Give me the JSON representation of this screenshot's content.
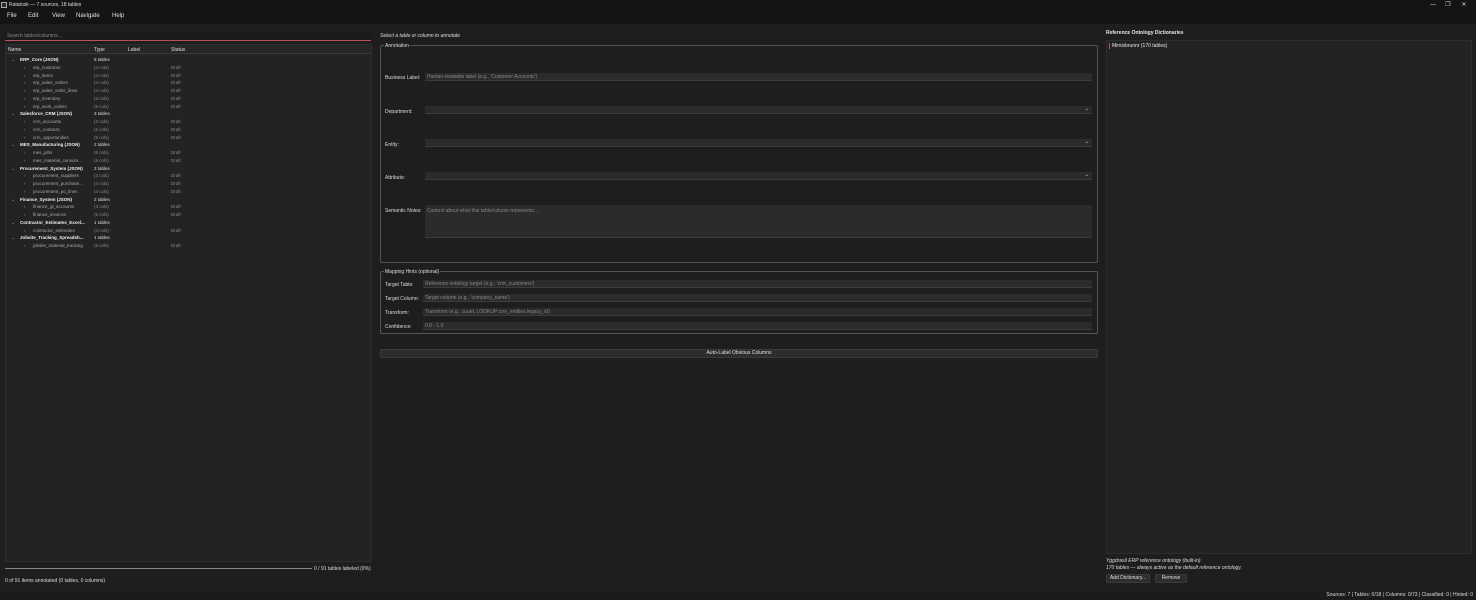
{
  "window": {
    "title": "Ratatosk — 7 sources, 18 tables",
    "icon": "app-icon",
    "controls": [
      "—",
      "❐",
      "✕"
    ]
  },
  "menu": [
    "File",
    "Edit",
    "View",
    "Navigate",
    "Help"
  ],
  "left": {
    "search_placeholder": "Search tables/columns...",
    "columns": [
      "Name",
      "Type",
      "Label",
      "Status"
    ],
    "rows": [
      {
        "kind": "source",
        "name": "ERP_Core (JSON)",
        "type": "6 tables",
        "status": ""
      },
      {
        "kind": "table",
        "name": "erp_customer",
        "type": "(4 cols)",
        "status": "Draft"
      },
      {
        "kind": "table",
        "name": "erp_items",
        "type": "(4 cols)",
        "status": "Draft"
      },
      {
        "kind": "table",
        "name": "erp_sales_orders",
        "type": "(4 cols)",
        "status": "Draft"
      },
      {
        "kind": "table",
        "name": "erp_sales_order_lines",
        "type": "(4 cols)",
        "status": "Draft"
      },
      {
        "kind": "table",
        "name": "erp_inventory",
        "type": "(3 cols)",
        "status": "Draft"
      },
      {
        "kind": "table",
        "name": "erp_work_orders",
        "type": "(5 cols)",
        "status": "Draft"
      },
      {
        "kind": "source",
        "name": "Salesforce_CRM (JSON)",
        "type": "3 tables",
        "status": ""
      },
      {
        "kind": "table",
        "name": "crm_accounts",
        "type": "(3 cols)",
        "status": "Draft"
      },
      {
        "kind": "table",
        "name": "crm_contacts",
        "type": "(5 cols)",
        "status": "Draft"
      },
      {
        "kind": "table",
        "name": "crm_opportunities",
        "type": "(5 cols)",
        "status": "Draft"
      },
      {
        "kind": "source",
        "name": "MES_Manufacturing (JSON)",
        "type": "2 tables",
        "status": ""
      },
      {
        "kind": "table",
        "name": "mes_jobs",
        "type": "(6 cols)",
        "status": "Draft"
      },
      {
        "kind": "table",
        "name": "mes_material_consum...",
        "type": "(5 cols)",
        "status": "Draft"
      },
      {
        "kind": "source",
        "name": "Procurement_System (JSON)",
        "type": "3 tables",
        "status": ""
      },
      {
        "kind": "table",
        "name": "procurement_suppliers",
        "type": "(3 cols)",
        "status": "Draft"
      },
      {
        "kind": "table",
        "name": "procurement_purchase...",
        "type": "(4 cols)",
        "status": "Draft"
      },
      {
        "kind": "table",
        "name": "procurement_po_lines",
        "type": "(4 cols)",
        "status": "Draft"
      },
      {
        "kind": "source",
        "name": "Finance_System (JSON)",
        "type": "2 tables",
        "status": ""
      },
      {
        "kind": "table",
        "name": "finance_gl_accounts",
        "type": "(3 cols)",
        "status": "Draft"
      },
      {
        "kind": "table",
        "name": "finance_invoices",
        "type": "(5 cols)",
        "status": "Draft"
      },
      {
        "kind": "source",
        "name": "Contractor_Estimates_Excel...",
        "type": "1 tables",
        "status": ""
      },
      {
        "kind": "table",
        "name": "contractor_estimates",
        "type": "(4 cols)",
        "status": "Draft"
      },
      {
        "kind": "source",
        "name": "Jobsite_Tracking_Spreadsh...",
        "type": "1 tables",
        "status": ""
      },
      {
        "kind": "table",
        "name": "jobsite_material_tracking",
        "type": "(5 cols)",
        "status": "Draft"
      }
    ],
    "progress_text": "0 / 91 tables labeled (0%)",
    "progress": 0,
    "summary": "0 of 91 items annotated (0 tables, 0 columns)"
  },
  "middle": {
    "hint": "Select a table or column to annotate",
    "annotation": {
      "title": "Annotation",
      "business_label": "Business Label:",
      "business_placeholder": "Human-readable label (e.g., 'Customer Accounts')",
      "department": "Department:",
      "entity": "Entity:",
      "attribute": "Attribute:",
      "notes": "Semantic Notes:",
      "notes_placeholder": "Context about what this table/column represents..."
    },
    "mapping": {
      "title": "Mapping Hints (optional)",
      "target_table": "Target Table:",
      "target_table_placeholder": "Reference ontology target (e.g., 'crm_customers')",
      "target_column": "Target Column:",
      "target_column_placeholder": "Target column (e.g., 'company_name')",
      "transform": "Transform:",
      "transform_placeholder": "Transform (e.g., cuuid, LOOKUP:crm_entities.legacy_id)",
      "confidence": "Confidence:",
      "confidence_placeholder": "0.0 - 1.0"
    },
    "auto_label_button": "Auto-Label Obvious Columns"
  },
  "right": {
    "title": "Reference Ontology Dictionaries",
    "items": [
      "Mimisbrunnr  (170 tables)"
    ],
    "info1": "Yggdrasil ERP reference ontology (built-in)",
    "info2": "170 tables — always active as the default reference ontology.",
    "add_button": "Add Dictionary...",
    "remove_button": "Remove"
  },
  "status_bar": "Sources: 7 | Tables: 0/18 | Columns: 0/73 | Classified: 0 | Hinted: 0"
}
